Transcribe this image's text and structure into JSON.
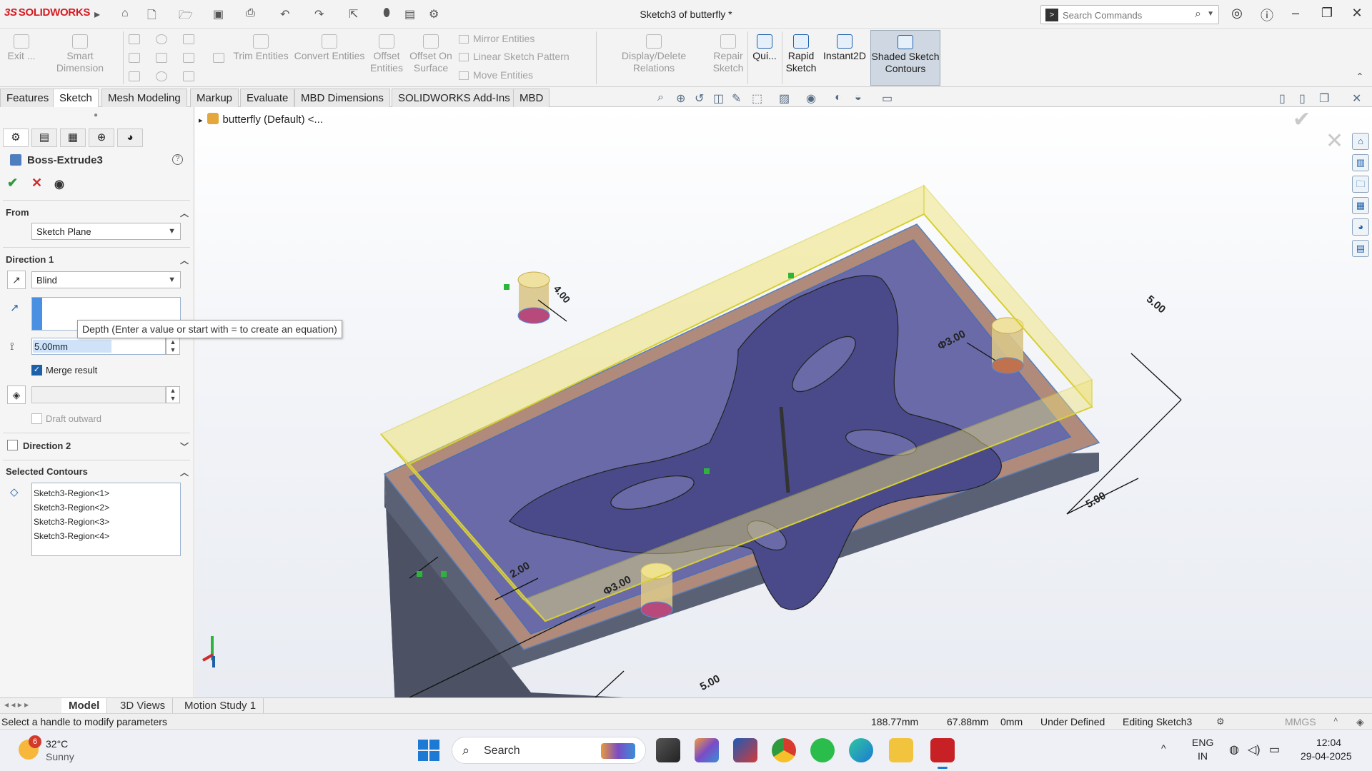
{
  "app": {
    "logo_ds": "3S",
    "logo_text": "SOLIDWORKS",
    "doc_title": "Sketch3 of butterfly *",
    "search_placeholder": "Search Commands"
  },
  "ribbon": {
    "exit": "Exit ...",
    "smart_dimension": "Smart Dimension",
    "trim_entities": "Trim Entities",
    "convert_entities": "Convert Entities",
    "offset_entities_1": "Offset",
    "offset_entities_2": "Entities",
    "offset_surface_1": "Offset On",
    "offset_surface_2": "Surface",
    "mirror_entities": "Mirror Entities",
    "linear_pattern": "Linear Sketch Pattern",
    "move_entities": "Move Entities",
    "display_delete": "Display/Delete Relations",
    "repair_1": "Repair",
    "repair_2": "Sketch",
    "quick": "Qui...",
    "rapid_1": "Rapid",
    "rapid_2": "Sketch",
    "instant2d": "Instant2D",
    "shaded_1": "Shaded Sketch",
    "shaded_2": "Contours"
  },
  "tabs": [
    "Features",
    "Sketch",
    "Mesh Modeling",
    "Markup",
    "Evaluate",
    "MBD Dimensions",
    "SOLIDWORKS Add-Ins",
    "MBD"
  ],
  "active_tab": "Sketch",
  "pm": {
    "title": "Boss-Extrude3",
    "help": "?",
    "from_label": "From",
    "from_value": "Sketch Plane",
    "dir1_label": "Direction 1",
    "dir1_type": "Blind",
    "depth_value": "5.00mm",
    "tooltip": "Depth (Enter a value or start with = to create an equation)",
    "merge_label": "Merge result",
    "merge_checked": true,
    "draft_label": "Draft outward",
    "dir2_label": "Direction 2",
    "contours_label": "Selected Contours",
    "contours": [
      "Sketch3-Region<1>",
      "Sketch3-Region<2>",
      "Sketch3-Region<3>",
      "Sketch3-Region<4>"
    ]
  },
  "tree": {
    "node": "butterfly (Default) <..."
  },
  "model": {
    "dims": [
      "4.00",
      "5.00",
      "Φ3.00",
      "5.00",
      "2.00",
      "Φ3.00",
      "5.00"
    ],
    "colors": {
      "frame": "#e8e08a",
      "pocket": "#6a6aa8",
      "base": "#5b6174",
      "rim": "#b08a7a"
    }
  },
  "bottom_tabs": [
    "Model",
    "3D Views",
    "Motion Study 1"
  ],
  "status": {
    "message": "Select a handle to modify parameters",
    "x": "188.77mm",
    "y": "67.88mm",
    "z": "0mm",
    "state": "Under Defined",
    "editing": "Editing Sketch3",
    "units": "MMGS"
  },
  "taskbar": {
    "weather_badge": "6",
    "temp": "32°C",
    "condition": "Sunny",
    "search": "Search",
    "lang_1": "ENG",
    "lang_2": "IN",
    "time": "12:04",
    "date": "29-04-2025"
  }
}
